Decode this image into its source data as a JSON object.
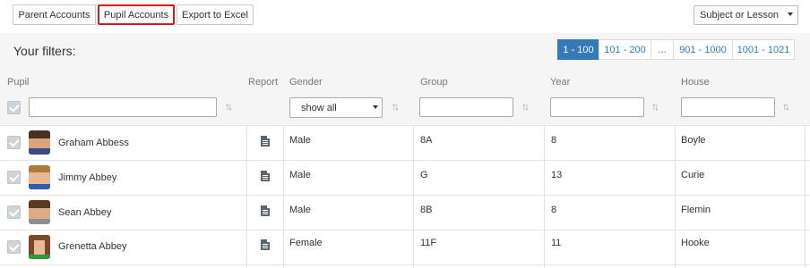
{
  "toolbar": {
    "parent_accounts": "Parent Accounts",
    "pupil_accounts": "Pupil Accounts",
    "export_excel": "Export to Excel",
    "subject_select": "Subject or Lesson"
  },
  "filters": {
    "title": "Your filters:"
  },
  "pagination": {
    "pages": [
      "1 - 100",
      "101 - 200",
      "...",
      "901 - 1000",
      "1001 - 1021"
    ],
    "active": "1 - 100"
  },
  "columns": {
    "pupil": "Pupil",
    "report": "Report",
    "gender": "Gender",
    "group": "Group",
    "year": "Year",
    "house": "House"
  },
  "gender_filter": {
    "selected": "show all"
  },
  "rows": [
    {
      "name": "Graham Abbess",
      "gender": "Male",
      "group": "8A",
      "year": "8",
      "house": "Boyle"
    },
    {
      "name": "Jimmy Abbey",
      "gender": "Male",
      "group": "G",
      "year": "13",
      "house": "Curie"
    },
    {
      "name": "Sean Abbey",
      "gender": "Male",
      "group": "8B",
      "year": "8",
      "house": "Flemin"
    },
    {
      "name": "Grenetta Abbey",
      "gender": "Female",
      "group": "11F",
      "year": "11",
      "house": "Hooke"
    }
  ],
  "colors": {
    "accent": "#337ab7",
    "highlight_border": "#e0141b"
  }
}
